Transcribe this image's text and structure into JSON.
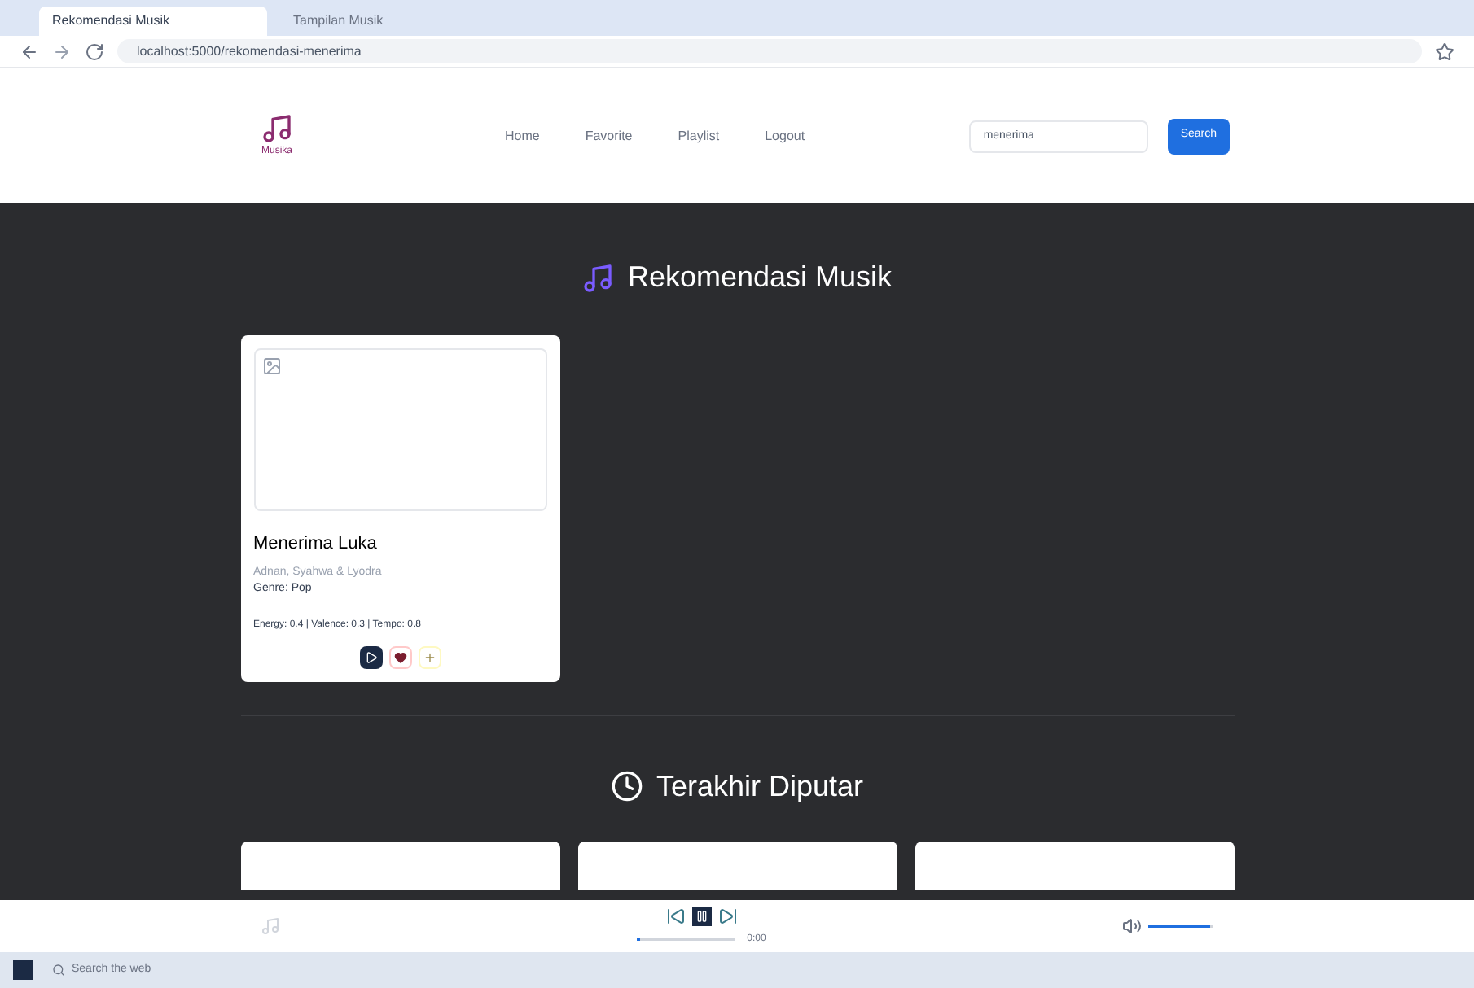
{
  "browser": {
    "tabs": [
      {
        "title": "Rekomendasi Musik",
        "selected": true
      },
      {
        "title": "Tampilan Musik",
        "selected": false
      }
    ],
    "url": "localhost:5000/rekomendasi-menerima"
  },
  "navbar": {
    "logo_text": "Musika",
    "links": [
      {
        "label": "Home"
      },
      {
        "label": "Favorite"
      },
      {
        "label": "Playlist"
      },
      {
        "label": "Logout"
      }
    ],
    "search": {
      "value": "menerima"
    },
    "search_button": "Search"
  },
  "recommend": {
    "title": "Rekomendasi Musik",
    "cards": [
      {
        "title": "Menerima Luka",
        "artist": "Adnan, Syahwa & Lyodra",
        "genre": "Genre: Pop",
        "features": "Energy: 0.4 | Valence: 0.3 | Tempo: 0.8"
      }
    ]
  },
  "recent": {
    "title": "Terakhir Diputar",
    "cards": [
      {
        "kind": "card"
      },
      {
        "kind": "card"
      },
      {
        "kind": "card"
      }
    ]
  },
  "player": {
    "progress": {
      "level": 0.04
    },
    "time": "0:00",
    "volume": {
      "level": 0.95
    }
  },
  "taskbar": {
    "search_placeholder": "Search the web"
  }
}
